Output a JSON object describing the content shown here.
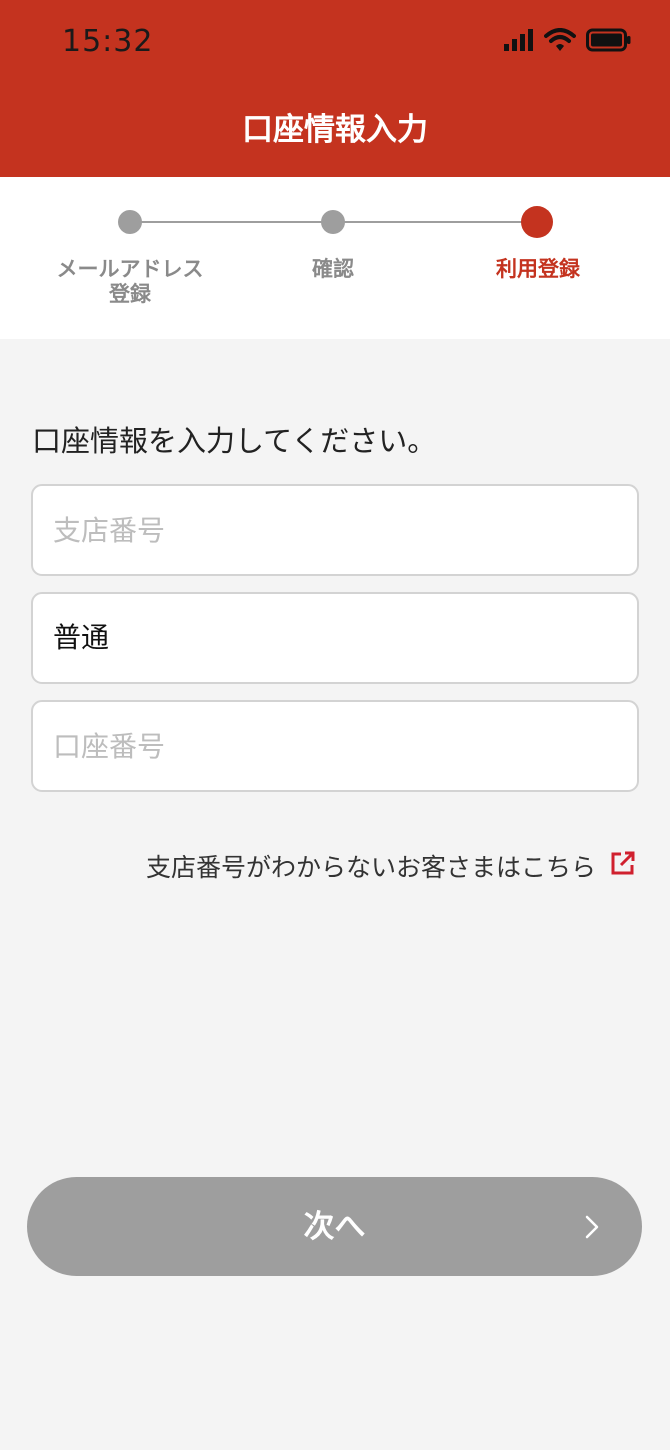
{
  "status_bar": {
    "time": "15:32",
    "icons": [
      "signal-icon",
      "wifi-icon",
      "battery-icon"
    ]
  },
  "header": {
    "title": "口座情報入力",
    "background_color": "#c4331f"
  },
  "stepper": {
    "steps": [
      {
        "label": "メールアドレス\n登録",
        "state": "done"
      },
      {
        "label": "確認",
        "state": "done"
      },
      {
        "label": "利用登録",
        "state": "current"
      }
    ],
    "inactive_color": "#9e9e9e",
    "active_color": "#c4331f"
  },
  "form": {
    "instruction": "口座情報を入力してください。",
    "branch_number": {
      "value": "",
      "placeholder": "支店番号"
    },
    "account_type": {
      "value": "普通"
    },
    "account_number": {
      "value": "",
      "placeholder": "口座番号"
    }
  },
  "help_link": {
    "label": "支店番号がわからないお客さまはこちら",
    "icon": "external-link-icon",
    "icon_color": "#d0202e"
  },
  "next_button": {
    "label": "次へ",
    "icon": "chevron-right-icon",
    "background_color": "#9e9e9e"
  }
}
